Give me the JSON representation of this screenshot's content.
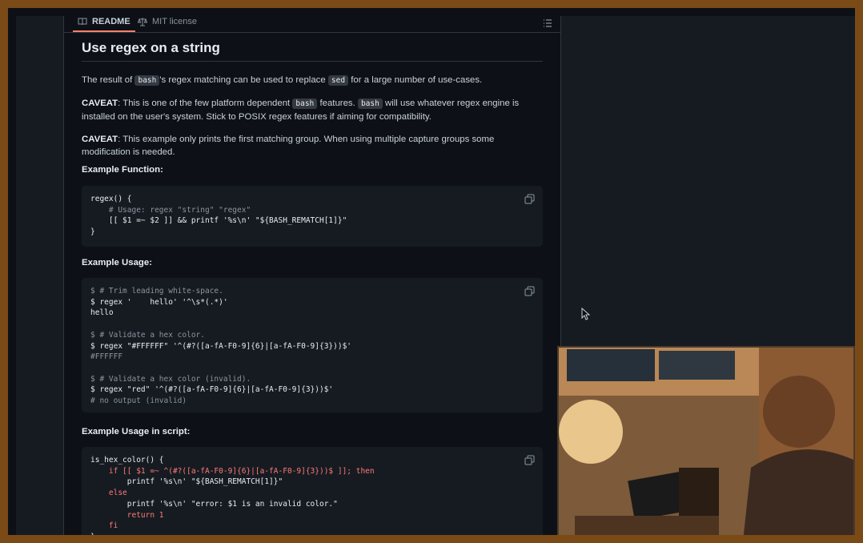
{
  "tabs": {
    "readme": "README",
    "license": "MIT license"
  },
  "section_title": "Use regex on a string",
  "intro": {
    "p1": "The result of",
    "c1": "bash",
    "p2": "'s regex matching can be used to replace",
    "c2": "sed",
    "p3": "for a large number of use-cases."
  },
  "caveat1": {
    "label": "CAVEAT",
    "t1": ": This is one of the few platform dependent",
    "c1": "bash",
    "t2": "features.",
    "c2": "bash",
    "t3": "will use whatever regex engine is installed on the user's system. Stick to POSIX regex features if aiming for compatibility."
  },
  "caveat2": {
    "label": "CAVEAT",
    "text": ": This example only prints the first matching group. When using multiple capture groups some modification is needed."
  },
  "headings": {
    "function": "Example Function:",
    "usage": "Example Usage:",
    "script": "Example Usage in script:"
  },
  "code_function": [
    "regex() {",
    "    # Usage: regex \"string\" \"regex\"",
    "    [[ $1 =~ $2 ]] && printf '%s\\n' \"${BASH_REMATCH[1]}\"",
    "}"
  ],
  "code_usage": [
    "$ # Trim leading white-space.",
    "$ regex '    hello' '^\\s*(.*)'",
    "hello",
    "",
    "$ # Validate a hex color.",
    "$ regex \"#FFFFFF\" '^(#?([a-fA-F0-9]{6}|[a-fA-F0-9]{3}))$'",
    "#FFFFFF",
    "",
    "$ # Validate a hex color (invalid).",
    "$ regex \"red\" '^(#?([a-fA-F0-9]{6}|[a-fA-F0-9]{3}))$'",
    "# no output (invalid)"
  ],
  "code_script": [
    "is_hex_color() {",
    "    if [[ $1 =~ ^(#?([a-fA-F0-9]{6}|[a-fA-F0-9]{3}))$ ]]; then",
    "        printf '%s\\n' \"${BASH_REMATCH[1]}\"",
    "    else",
    "        printf '%s\\n' \"error: $1 is an invalid color.\"",
    "        return 1",
    "    fi",
    "}"
  ],
  "icons": {
    "readme": "book-icon",
    "license": "scale-icon",
    "toc": "list-icon",
    "copy": "copy-icon",
    "cursor": "mouse-pointer-icon"
  },
  "colors": {
    "frame": "#7a4a17",
    "background": "#0d1117",
    "code_background": "#161b22",
    "tab_underline": "#f78166",
    "keyword": "#ff7b72",
    "comment": "#8b949e"
  }
}
